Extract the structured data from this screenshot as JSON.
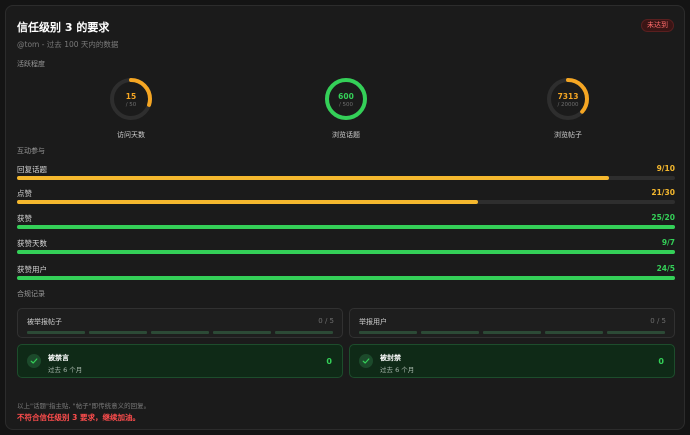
{
  "header": {
    "title": "信任级别 3 的要求",
    "status_badge": "未达到",
    "subtitle": "@tom - 过去 100 天内的数据"
  },
  "activity": {
    "section_label": "活跃程度",
    "rings": [
      {
        "value": "15",
        "target": "/ 50",
        "label": "访问天数",
        "fraction": 0.3,
        "color": "#f5a623"
      },
      {
        "value": "600",
        "target": "/ 500",
        "label": "浏览话题",
        "fraction": 1.0,
        "color": "#34d058"
      },
      {
        "value": "7313",
        "target": "/ 20000",
        "label": "浏览帖子",
        "fraction": 0.3657,
        "color": "#f5a623"
      }
    ]
  },
  "interaction": {
    "section_label": "互动参与",
    "bars": [
      {
        "label": "回复话题",
        "value": "9/10",
        "fraction": 0.9,
        "color": "#f5b82e"
      },
      {
        "label": "点赞",
        "value": "21/30",
        "fraction": 0.7,
        "color": "#f5b82e"
      },
      {
        "label": "获赞",
        "value": "25/20",
        "fraction": 1.0,
        "color": "#34d058"
      },
      {
        "label": "获赞天数",
        "value": "9/7",
        "fraction": 1.0,
        "color": "#34d058"
      },
      {
        "label": "获赞用户",
        "value": "24/5",
        "fraction": 1.0,
        "color": "#34d058"
      }
    ]
  },
  "compliance": {
    "section_label": "合规记录",
    "flagged_posts": {
      "label": "被举报帖子",
      "count": "0 / 5"
    },
    "flagged_users": {
      "label": "举报用户",
      "count": "0 / 5"
    },
    "silenced": {
      "title": "被禁言",
      "period": "过去 6 个月",
      "value": "0"
    },
    "suspended": {
      "title": "被封禁",
      "period": "过去 6 个月",
      "value": "0"
    }
  },
  "footer": {
    "note": "以上\"话题\"指主贴, \"帖子\"即传统意义的回复。",
    "verdict": "不符合信任级别 3 要求，继续加油。"
  },
  "colors": {
    "warning": "#f5a623",
    "success": "#34d058",
    "danger": "#ff4d4d"
  }
}
